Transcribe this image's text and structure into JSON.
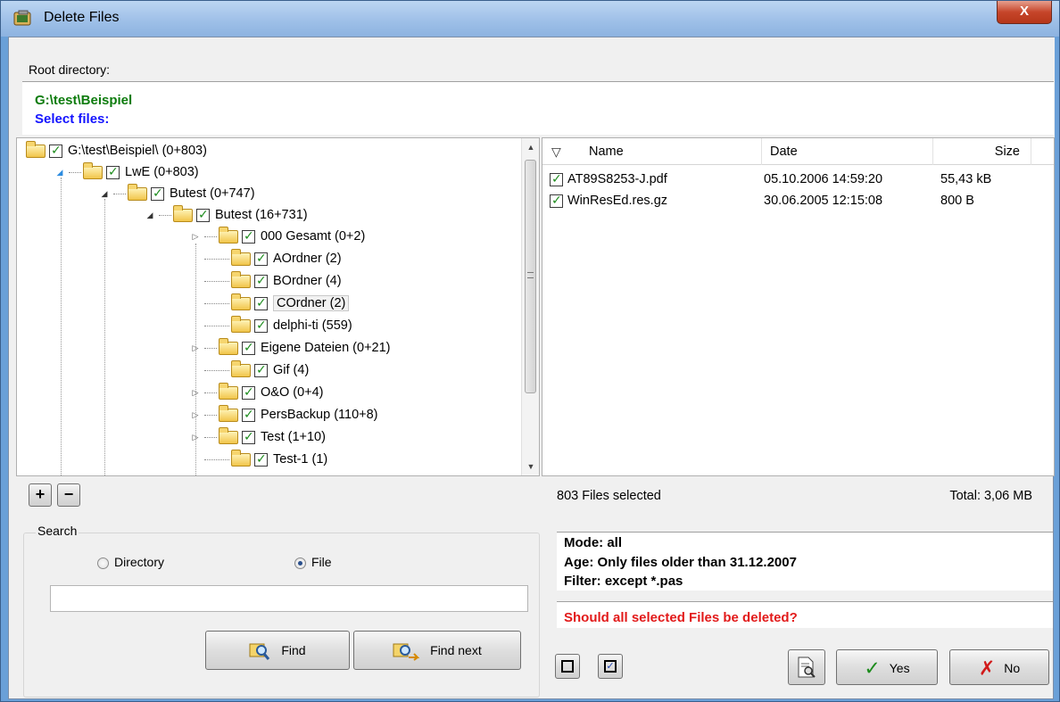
{
  "window": {
    "title": "Delete Files",
    "close_glyph": "X"
  },
  "root": {
    "label": "Root directory:",
    "path": "G:\\test\\Beispiel",
    "select_label": "Select files:"
  },
  "tree": {
    "nodes": [
      {
        "label": "G:\\test\\Beispiel\\ (0+803)"
      },
      {
        "label": "LwE (0+803)"
      },
      {
        "label": "Butest (0+747)"
      },
      {
        "label": "Butest (16+731)"
      },
      {
        "label": "000 Gesamt (0+2)"
      },
      {
        "label": "AOrdner (2)"
      },
      {
        "label": "BOrdner (4)"
      },
      {
        "label": "COrdner (2)"
      },
      {
        "label": "delphi-ti (559)"
      },
      {
        "label": "Eigene Dateien (0+21)"
      },
      {
        "label": "Gif (4)"
      },
      {
        "label": "O&O (0+4)"
      },
      {
        "label": "PersBackup (110+8)"
      },
      {
        "label": "Test (1+10)"
      },
      {
        "label": "Test-1 (1)"
      }
    ]
  },
  "file_list": {
    "columns": [
      "Name",
      "Date",
      "Size"
    ],
    "rows": [
      {
        "name": "AT89S8253-J.pdf",
        "date": "05.10.2006 14:59:20",
        "size": "55,43 kB"
      },
      {
        "name": "WinResEd.res.gz",
        "date": "30.06.2005 12:15:08",
        "size": "800 B"
      }
    ]
  },
  "status": {
    "files_selected": "803 Files selected",
    "total": "Total: 3,06 MB"
  },
  "info": {
    "mode": "Mode: all",
    "age": "Age: Only files older than 31.12.2007",
    "filter": "Filter: except *.pas",
    "question": "Should all selected Files be deleted?"
  },
  "search": {
    "legend": "Search",
    "option_directory": "Directory",
    "option_file": "File",
    "selected_option": "File",
    "input_value": "",
    "find_label": "Find",
    "find_next_label": "Find next"
  },
  "buttons": {
    "expand_glyph": "+",
    "collapse_glyph": "−",
    "yes_label": "Yes",
    "no_label": "No"
  },
  "colors": {
    "root_path": "#0e7c0e",
    "select_label": "#1414ff",
    "question": "#e21a1a",
    "check": "#1d8c1d"
  }
}
